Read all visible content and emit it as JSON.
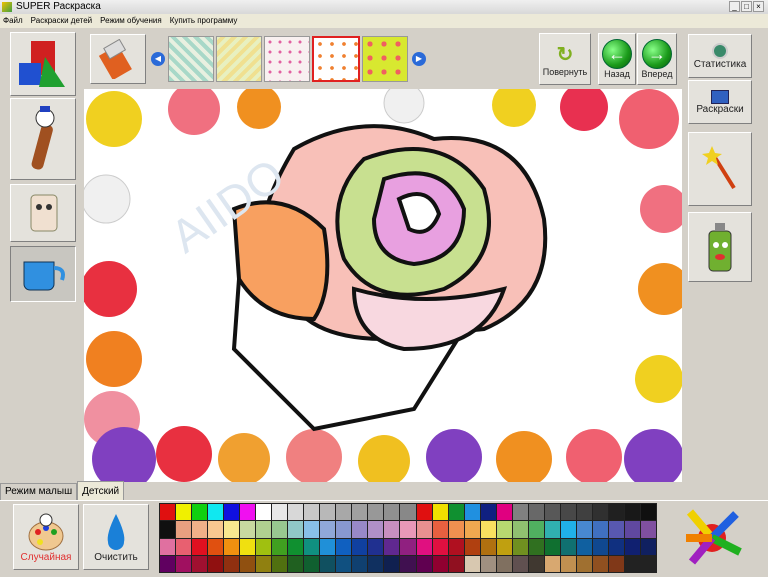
{
  "window": {
    "title": "SUPER Раскраска",
    "controls": [
      "_",
      "□",
      "×"
    ]
  },
  "menu": [
    "Файл",
    "Раскраски детей",
    "Режим обучения",
    "Купить программу"
  ],
  "toolbar": {
    "rotate": "Повернуть",
    "back": "Назад",
    "forward": "Вперед",
    "prev_arrow": "◀",
    "next_arrow": "▶"
  },
  "right": {
    "stats": "Статистика",
    "pages": "Раскраски"
  },
  "tabs": [
    "Режим малыш",
    "Детский"
  ],
  "bottom": {
    "random": "Случайная",
    "clear": "Очистить"
  },
  "watermark": "AIIDO",
  "palette": [
    [
      "#e01010",
      "#f0f000",
      "#10d010",
      "#10e8f0",
      "#1010e0",
      "#f010f0",
      "#ffffff",
      "#e8e8e8",
      "#d8d8d8",
      "#c8c8c8",
      "#b8b8b8",
      "#a8a8a8",
      "#a0a0a0",
      "#989898",
      "#909090",
      "#888888",
      "#e01010",
      "#f0e000",
      "#109030",
      "#2090e0",
      "#102080",
      "#e00080",
      "#808080",
      "#686868",
      "#585858",
      "#484848",
      "#404040",
      "#303030",
      "#202020",
      "#181818",
      "#101010"
    ],
    [
      "#101010",
      "#e8a080",
      "#f0b088",
      "#f8c890",
      "#f8e890",
      "#c8d8a0",
      "#b0d090",
      "#98c890",
      "#90c8c8",
      "#88c0e8",
      "#90a8d8",
      "#8898d0",
      "#9888c8",
      "#b090c8",
      "#c890c0",
      "#e898b8",
      "#e89090",
      "#e86040",
      "#f09050",
      "#f0a850",
      "#f8e060",
      "#b8d870",
      "#90c070",
      "#50b060",
      "#30b0b0",
      "#20b0e8",
      "#4888d0",
      "#4070c0",
      "#5858b0",
      "#6048a0",
      "#8050a0"
    ],
    [
      "#e070a0",
      "#e86070",
      "#e01020",
      "#e05010",
      "#f09010",
      "#f0e010",
      "#a0c010",
      "#40a020",
      "#109030",
      "#109080",
      "#2090d8",
      "#1060c0",
      "#1040a0",
      "#203090",
      "#602890",
      "#902080",
      "#e01080",
      "#e01040",
      "#b01020",
      "#b04010",
      "#b07010",
      "#c0a010",
      "#709020",
      "#307020",
      "#107030",
      "#107070",
      "#1060a0",
      "#104890",
      "#103080",
      "#102070",
      "#102060"
    ],
    [
      "#600060",
      "#a01060",
      "#a01030",
      "#901010",
      "#903010",
      "#905010",
      "#908010",
      "#507010",
      "#206020",
      "#106030",
      "#105060",
      "#105080",
      "#104070",
      "#103060",
      "#102050",
      "#401050",
      "#600050",
      "#900030",
      "#901020",
      "#d8c8b0",
      "#a09080",
      "#807060",
      "#605050",
      "#403830",
      "#d8a870",
      "#c09050",
      "#a07030",
      "#905020",
      "#803818"
    ]
  ]
}
